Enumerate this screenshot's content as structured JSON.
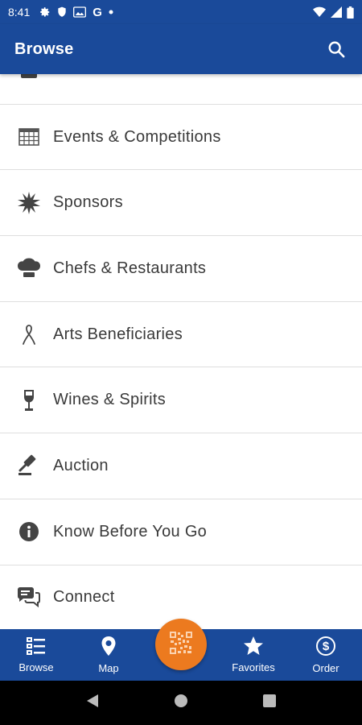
{
  "status_bar": {
    "time": "8:41",
    "left_icons": [
      "gear-icon",
      "shield-icon",
      "photo-icon",
      "google-icon",
      "dot-icon"
    ],
    "google_letter": "G",
    "right_icons": [
      "wifi-icon",
      "signal-icon",
      "battery-icon"
    ]
  },
  "app_bar": {
    "title": "Browse",
    "search_icon": "search-icon"
  },
  "list": {
    "items": [
      {
        "label": "",
        "icon": "partial-icon"
      },
      {
        "label": "Events & Competitions",
        "icon": "calendar-icon"
      },
      {
        "label": "Sponsors",
        "icon": "starburst-icon"
      },
      {
        "label": "Chefs & Restaurants",
        "icon": "chef-hat-icon"
      },
      {
        "label": "Arts Beneficiaries",
        "icon": "ribbon-icon"
      },
      {
        "label": "Wines & Spirits",
        "icon": "wine-glass-icon"
      },
      {
        "label": "Auction",
        "icon": "gavel-icon"
      },
      {
        "label": "Know Before You Go",
        "icon": "info-icon"
      },
      {
        "label": "Connect",
        "icon": "chat-icon"
      }
    ]
  },
  "bottom_nav": {
    "items": [
      {
        "label": "Browse",
        "icon": "list-icon"
      },
      {
        "label": "Map",
        "icon": "map-pin-icon"
      },
      {
        "label": "Favorites",
        "icon": "star-icon"
      },
      {
        "label": "Order",
        "icon": "dollar-icon"
      }
    ],
    "fab_icon": "qr-code-icon"
  },
  "system_nav": {
    "icons": [
      "back-icon",
      "home-icon",
      "recents-icon"
    ]
  },
  "colors": {
    "primary": "#1a4a9a",
    "accent": "#ec7a1f",
    "text": "#3a3a3a",
    "divider": "#dedede"
  }
}
